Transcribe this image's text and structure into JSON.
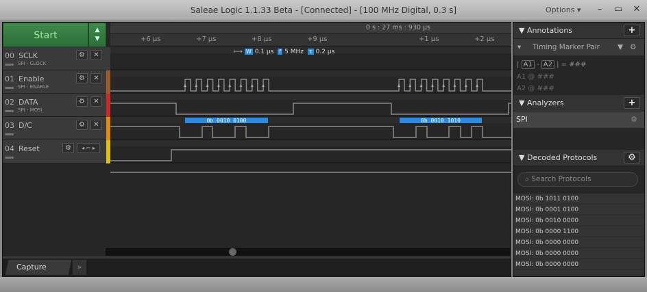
{
  "window": {
    "title": "Saleae Logic 1.1.33 Beta - [Connected] - [100 MHz Digital, 0.3 s]",
    "options": "Options ▾",
    "minimize": "–",
    "maximize": "▭",
    "close": "✕"
  },
  "start": {
    "label": "Start",
    "arrows": "▲▼"
  },
  "ruler": {
    "reference": "0 s : 27 ms : 930 μs",
    "ticks": [
      "+6 μs",
      "+7 μs",
      "+8 μs",
      "+9 μs",
      "+1 μs",
      "+2 μs"
    ]
  },
  "measurements": {
    "width": "0.1 μs",
    "frequency": "5 MHz",
    "period": "0.2 μs",
    "w_icon": "W",
    "f_icon": "f",
    "t_icon": "τ"
  },
  "channels": [
    {
      "num": "00",
      "name": "SCLK",
      "sub": "SPI - CLOCK",
      "color": "#3a3a3a"
    },
    {
      "num": "01",
      "name": "Enable",
      "sub": "SPI - ENABLE",
      "color": "#9a5a2a"
    },
    {
      "num": "02",
      "name": "DATA",
      "sub": "SPI - MOSI",
      "color": "#cc2a2a"
    },
    {
      "num": "03",
      "name": "D/C",
      "sub": "",
      "color": "#e08a10"
    },
    {
      "num": "04",
      "name": "Reset",
      "sub": "",
      "color": "#e0c010"
    }
  ],
  "decoded_bars": [
    "0b  0010  0100",
    "0b  0010  1010"
  ],
  "bottom": {
    "capture_tab": "Capture",
    "more": "»"
  },
  "annotations": {
    "title": "Annotations",
    "add": "+",
    "marker": "Timing Marker Pair",
    "a1": "A1",
    "a2": "A2",
    "diff": "= ###",
    "a1_at": "@  ###",
    "a2_at": "@  ###"
  },
  "analyzers": {
    "title": "Analyzers",
    "add": "+",
    "items": [
      "SPI"
    ]
  },
  "decoded": {
    "title": "Decoded Protocols",
    "search_placeholder": "Search Protocols",
    "items": [
      "MOSI: 0b  1011  0100",
      "MOSI: 0b  0001  0100",
      "MOSI: 0b  0010  0000",
      "MOSI: 0b  0000  1100",
      "MOSI: 0b  0000  0000",
      "MOSI: 0b  0000  0000",
      "MOSI: 0b  0000  0000"
    ]
  },
  "colors": {
    "accent": "#2a8ae0",
    "start": "#3e8a4a"
  }
}
